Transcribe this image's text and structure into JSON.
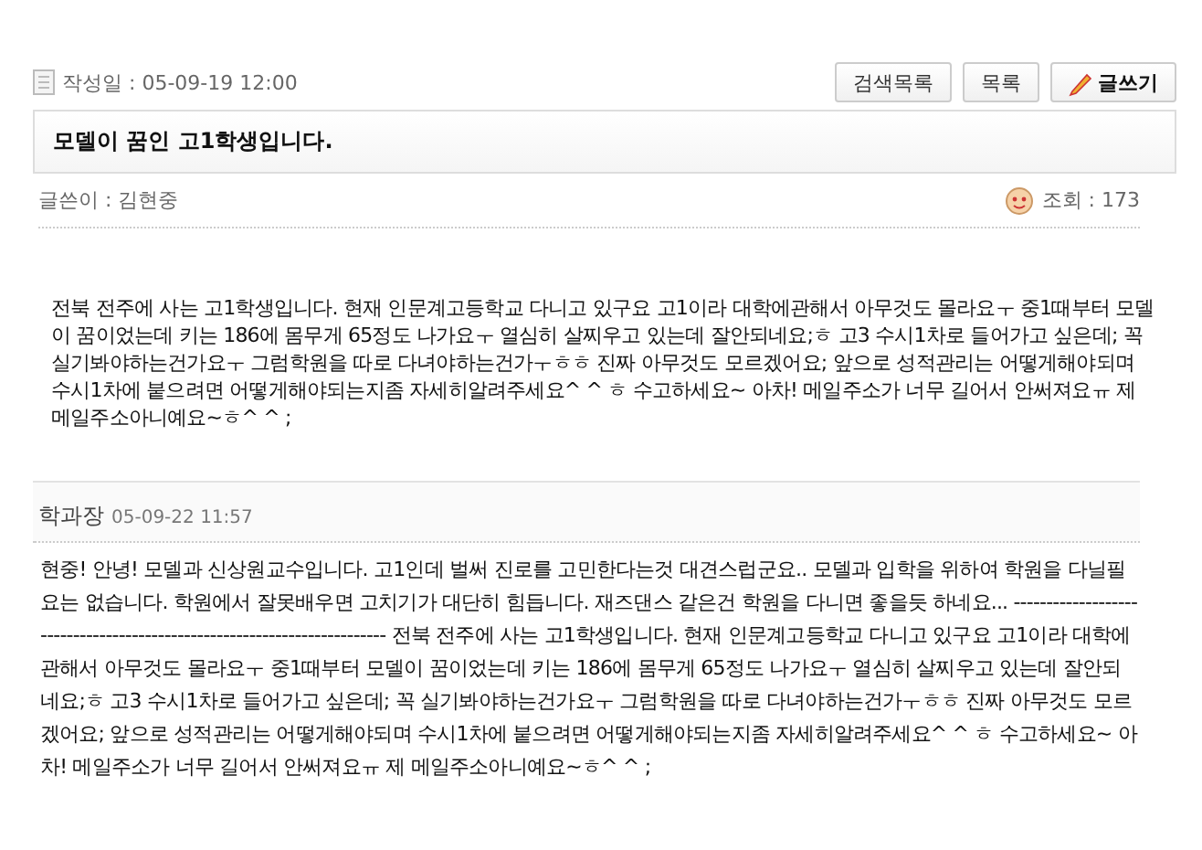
{
  "post": {
    "date_label": "작성일 : 05-09-19 12:00",
    "buttons": [
      {
        "label": "검색목록",
        "kind": "plain"
      },
      {
        "label": "목록",
        "kind": "plain"
      },
      {
        "label": "글쓰기",
        "kind": "write"
      }
    ],
    "title": "모델이 꿈인 고1학생입니다.",
    "author": "글쓴이 : 김현중",
    "views": "조회 : 173",
    "body": "전북 전주에 사는 고1학생입니다. 현재 인문계고등학교 다니고 있구요 고1이라 대학에관해서 아무것도 몰라요ㅜ 중1때부터 모델이 꿈이었는데 키는 186에 몸무게 65정도 나가요ㅜ 열심히 살찌우고 있는데 잘안되네요;ㅎ 고3 수시1차로 들어가고 싶은데; 꼭 실기봐야하는건가요ㅜ 그럼학원을 따로 다녀야하는건가ㅜㅎㅎ 진짜 아무것도 모르겠어요; 앞으로 성적관리는 어떻게해야되며 수시1차에 붙으려면 어떻게해야되는지좀 자세히알려주세요^ ^ ㅎ 수고하세요~ 아차! 메일주소가 너무 길어서 안써져요ㅠ 제 메일주소아니예요~ㅎ^ ^ ;"
  },
  "comments": [
    {
      "author": "학과장",
      "date": "05-09-22 11:57",
      "text": "현중! 안녕! 모델과 신상원교수입니다. 고1인데 벌써 진로를 고민한다는것 대견스럽군요.. 모델과 입학을 위하여 학원을 다닐필요는 없습니다. 학원에서 잘못배우면 고치기가 대단히 힘듭니다. 재즈댄스 같은건 학원을 다니면 좋을듯 하네요... ------------------------------------------------------------------------ 전북 전주에 사는 고1학생입니다. 현재 인문계고등학교 다니고 있구요 고1이라 대학에관해서 아무것도 몰라요ㅜ 중1때부터 모델이 꿈이었는데 키는 186에 몸무게 65정도 나가요ㅜ 열심히 살찌우고 있는데 잘안되네요;ㅎ 고3 수시1차로 들어가고 싶은데; 꼭 실기봐야하는건가요ㅜ 그럼학원을 따로 다녀야하는건가ㅜㅎㅎ 진짜 아무것도 모르겠어요; 앞으로 성적관리는 어떻게해야되며 수시1차에 붙으려면 어떻게해야되는지좀 자세히알려주세요^ ^ ㅎ 수고하세요~ 아차! 메일주소가 너무 길어서 안써져요ㅠ 제 메일주소아니예요~ㅎ^ ^ ;"
    }
  ]
}
